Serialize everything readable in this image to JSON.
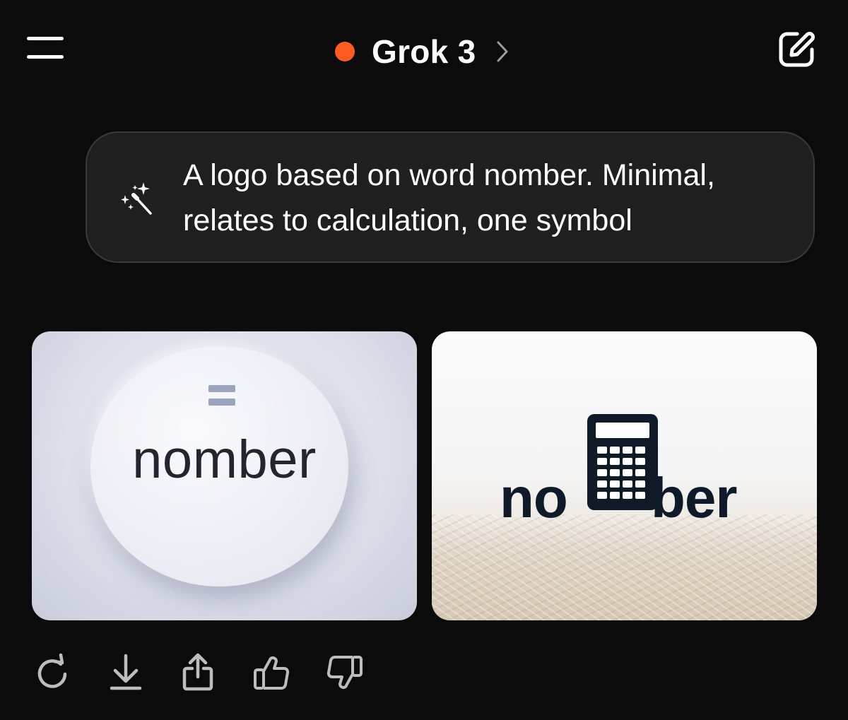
{
  "header": {
    "model_name": "Grok 3",
    "status_color": "#ff5a1f"
  },
  "prompt": {
    "text": "A logo based on word nomber. Minimal, relates to calculation, one symbol",
    "icon": "magic-wand-icon"
  },
  "images": [
    {
      "style": "white 3D disc with equals sign",
      "logo_text": "nomber"
    },
    {
      "style": "calculator replacing the letter m",
      "logo_left": "no",
      "logo_right": "ber"
    }
  ],
  "actions": [
    {
      "icon": "regenerate-icon"
    },
    {
      "icon": "download-icon"
    },
    {
      "icon": "share-icon"
    },
    {
      "icon": "thumbs-up-icon"
    },
    {
      "icon": "thumbs-down-icon"
    }
  ],
  "colors": {
    "background": "#0b0b0b",
    "bubble": "#1f1f1f",
    "accent": "#ff5a1f"
  }
}
